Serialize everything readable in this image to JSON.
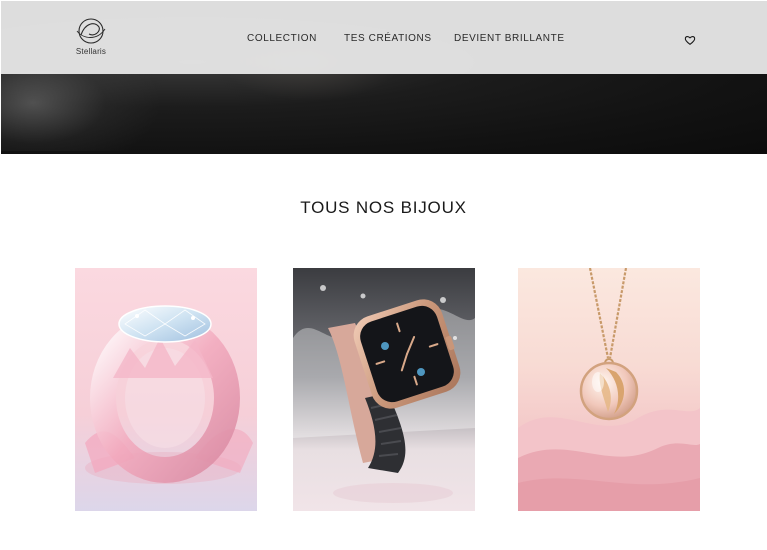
{
  "brand": {
    "name": "Stellaris",
    "icon": "stellaris-logo-icon"
  },
  "nav": {
    "items": [
      {
        "label": "COLLECTION"
      },
      {
        "label": "TES CRÉATIONS"
      },
      {
        "label": "DEVIENT BRILLANTE"
      }
    ],
    "favorites_icon": "heart-icon"
  },
  "section": {
    "title": "TOUS NOS BIJOUX"
  },
  "products": [
    {
      "kind": "crystal-ring",
      "icon": "ring-image"
    },
    {
      "kind": "smartwatch",
      "icon": "watch-image"
    },
    {
      "kind": "pendant-necklace",
      "icon": "necklace-image"
    }
  ],
  "colors": {
    "header_bg": "#e4e4e4",
    "hero_bg": "#121212",
    "text": "#1a1a1a",
    "pink_soft": "#f6d9dc"
  }
}
